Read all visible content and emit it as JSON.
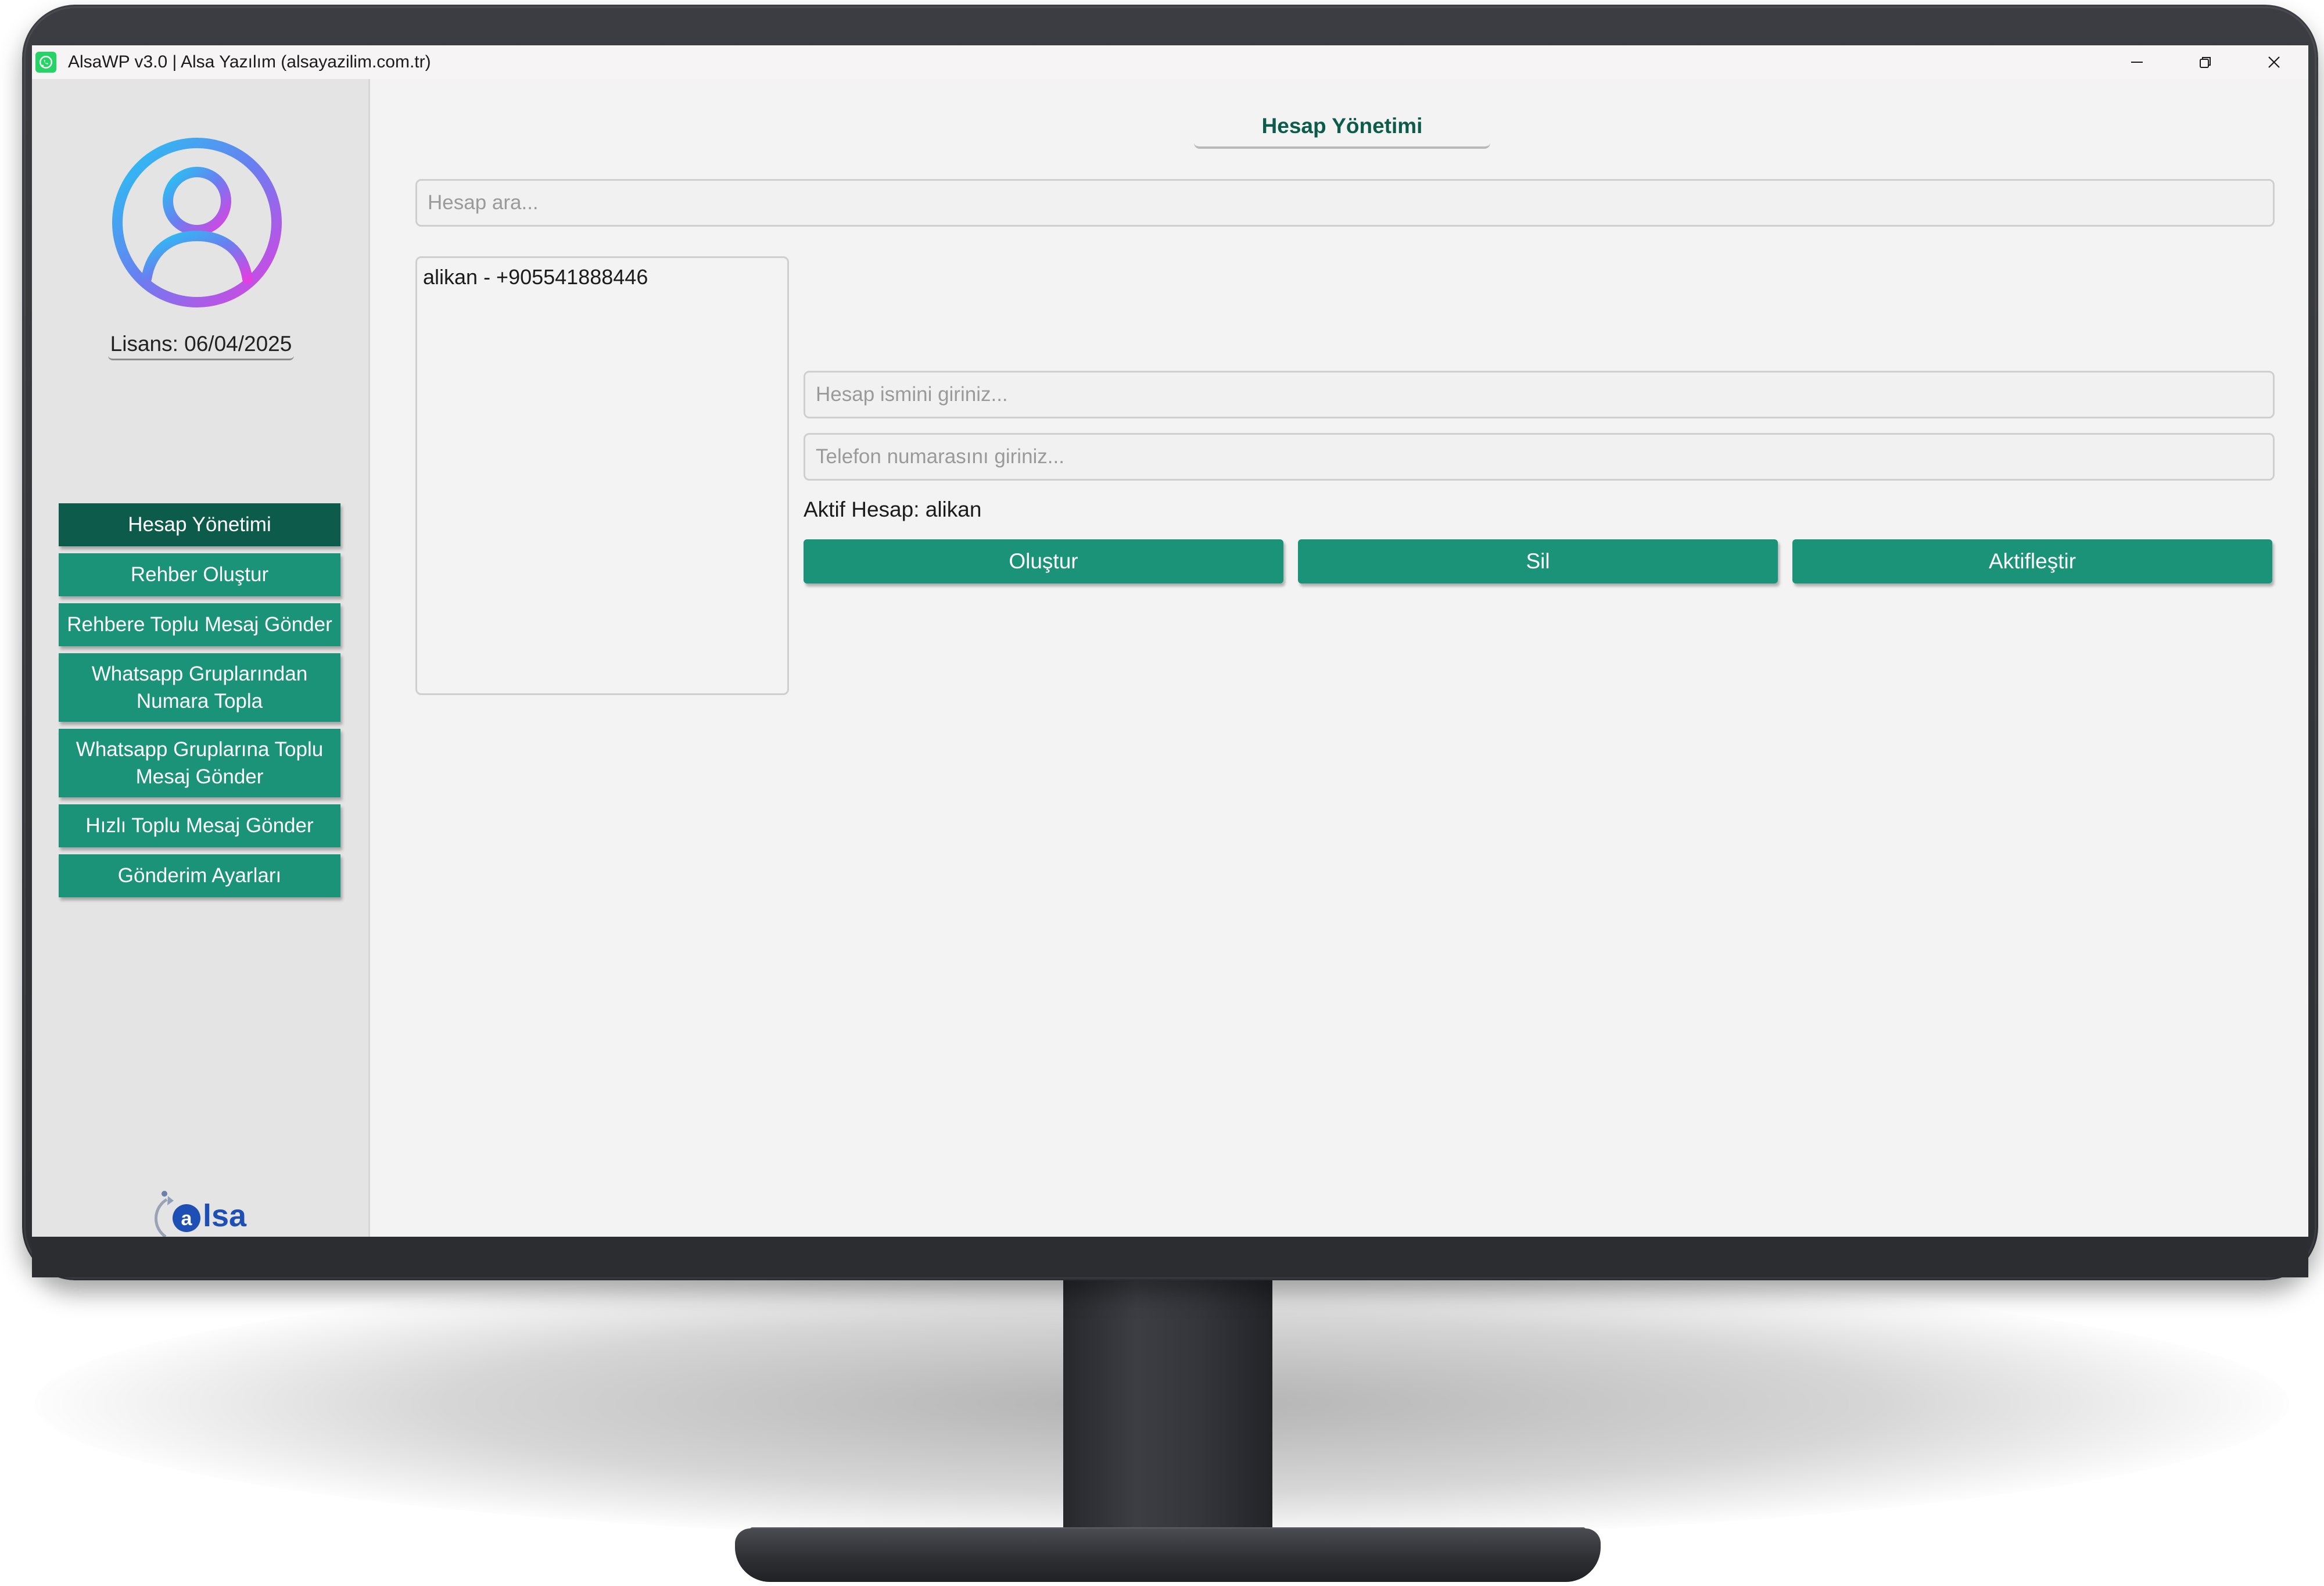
{
  "window": {
    "title": "AlsaWP v3.0 | Alsa Yazılım (alsayazilim.com.tr)",
    "app_icon": "whatsapp-icon",
    "controls": [
      "minimize-icon",
      "restore-icon",
      "close-icon"
    ]
  },
  "sidebar": {
    "avatar_icon": "user-avatar-icon",
    "license": "Lisans: 06/04/2025",
    "items": [
      {
        "label": "Hesap Yönetimi",
        "active": true
      },
      {
        "label": "Rehber Oluştur",
        "active": false
      },
      {
        "label": "Rehbere Toplu Mesaj Gönder",
        "active": false
      },
      {
        "label": "Whatsapp Gruplarından Numara Topla",
        "active": false
      },
      {
        "label": "Whatsapp Gruplarına Toplu Mesaj Gönder",
        "active": false
      },
      {
        "label": "Hızlı Toplu Mesaj Gönder",
        "active": false
      },
      {
        "label": "Gönderim Ayarları",
        "active": false
      }
    ],
    "logo_text": "alsa"
  },
  "main": {
    "title": "Hesap Yönetimi",
    "search": {
      "placeholder": "Hesap ara...",
      "value": ""
    },
    "accounts": [
      "alikan - +905541888446"
    ],
    "name_input": {
      "placeholder": "Hesap ismini giriniz...",
      "value": ""
    },
    "phone_input": {
      "placeholder": "Telefon numarasını giriniz...",
      "value": ""
    },
    "active_account": "Aktif Hesap: alikan",
    "buttons": {
      "create": "Oluştur",
      "delete": "Sil",
      "activate": "Aktifleştir"
    }
  },
  "colors": {
    "accent": "#1a9378",
    "accent_dark": "#0d5b4b",
    "window_bg": "#f3f3f3",
    "sidebar_bg": "#e4e4e4",
    "logo_blue": "#1e4fb5"
  }
}
